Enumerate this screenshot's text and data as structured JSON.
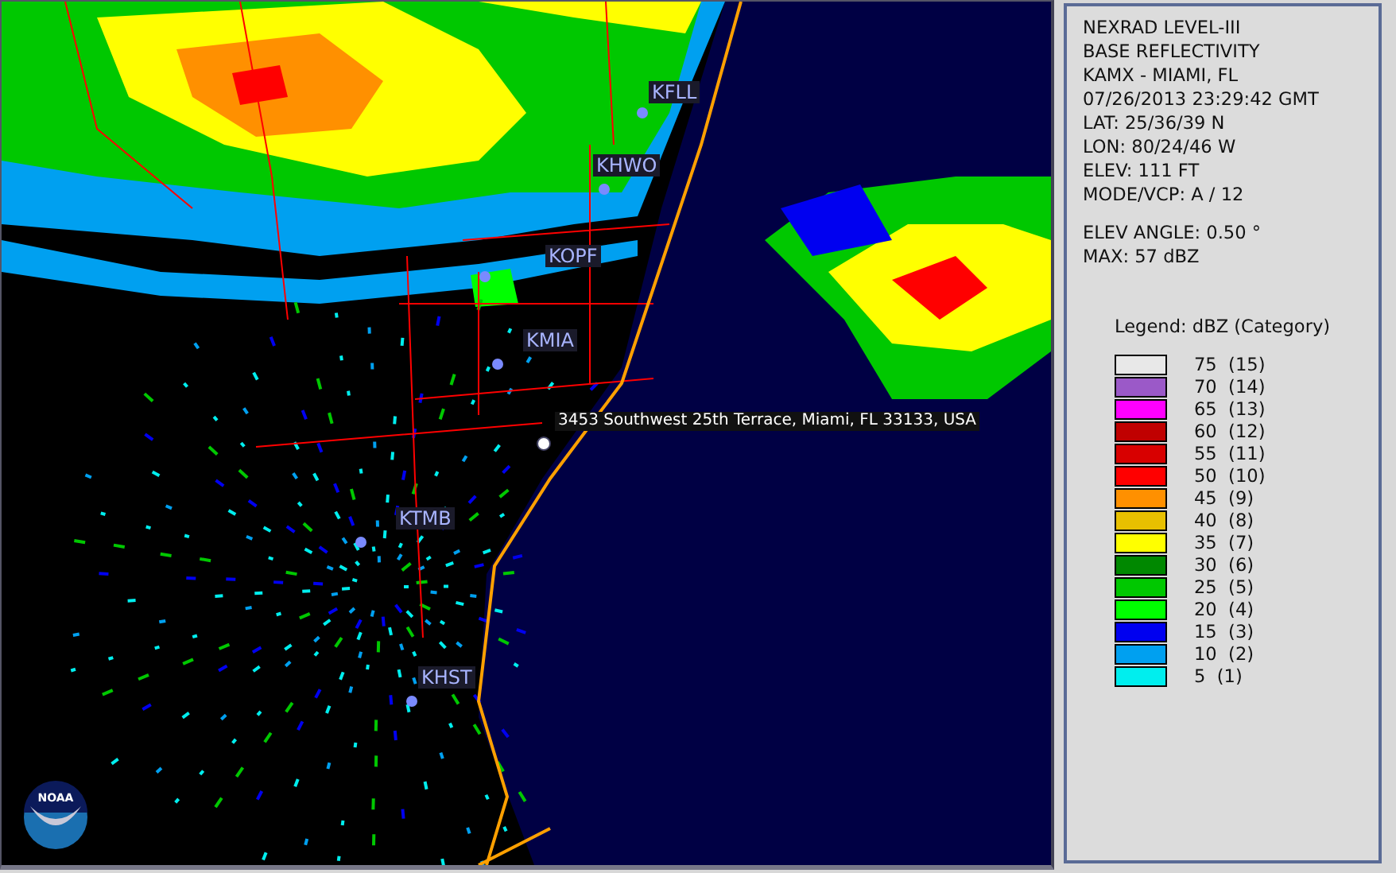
{
  "map": {
    "stations": [
      {
        "label": "KFLL"
      },
      {
        "label": "KHWO"
      },
      {
        "label": "KOPF"
      },
      {
        "label": "KMIA"
      },
      {
        "label": "KTMB"
      },
      {
        "label": "KHST"
      }
    ],
    "address": "3453 Southwest 25th Terrace, Miami, FL 33133, USA",
    "logo_text": "NOAA"
  },
  "info": {
    "lines": [
      "NEXRAD LEVEL-III",
      "BASE REFLECTIVITY",
      "KAMX - MIAMI, FL",
      "07/26/2013 23:29:42 GMT",
      "LAT: 25/36/39 N",
      "LON: 80/24/46 W",
      "ELEV: 111 FT",
      "MODE/VCP: A / 12"
    ],
    "extra_lines": [
      "ELEV ANGLE: 0.50 °",
      "MAX: 57 dBZ"
    ]
  },
  "legend": {
    "title": "Legend: dBZ (Category)",
    "items": [
      {
        "label": "75  (15)",
        "color": "#e8e8e8"
      },
      {
        "label": "70  (14)",
        "color": "#9b59c8"
      },
      {
        "label": "65  (13)",
        "color": "#ff00ff"
      },
      {
        "label": "60  (12)",
        "color": "#c00000"
      },
      {
        "label": "55  (11)",
        "color": "#d80000"
      },
      {
        "label": "50  (10)",
        "color": "#ff0000"
      },
      {
        "label": "45  (9)",
        "color": "#ff9000"
      },
      {
        "label": "40  (8)",
        "color": "#e8c000"
      },
      {
        "label": "35  (7)",
        "color": "#ffff00"
      },
      {
        "label": "30  (6)",
        "color": "#008800"
      },
      {
        "label": "25  (5)",
        "color": "#00c800"
      },
      {
        "label": "20  (4)",
        "color": "#00ff00"
      },
      {
        "label": "15  (3)",
        "color": "#0000f0"
      },
      {
        "label": "10  (2)",
        "color": "#00a0f0"
      },
      {
        "label": "5  (1)",
        "color": "#00eeee"
      }
    ]
  }
}
